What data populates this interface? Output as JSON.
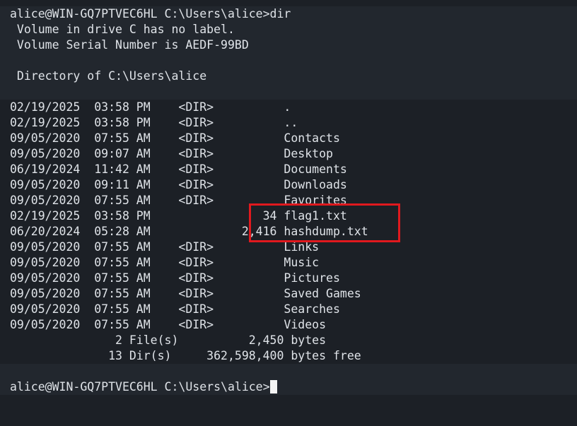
{
  "terminal": {
    "prompt_command": "alice@WIN-GQ7PTVEC6HL C:\\Users\\alice>dir",
    "volume_label": " Volume in drive C has no label.",
    "volume_serial": " Volume Serial Number is AEDF-99BD",
    "directory_of": " Directory of C:\\Users\\alice",
    "entries": [
      "02/19/2025  03:58 PM    <DIR>          .",
      "02/19/2025  03:58 PM    <DIR>          ..",
      "09/05/2020  07:55 AM    <DIR>          Contacts",
      "09/05/2020  09:07 AM    <DIR>          Desktop",
      "06/19/2024  11:42 AM    <DIR>          Documents",
      "09/05/2020  09:11 AM    <DIR>          Downloads",
      "09/05/2020  07:55 AM    <DIR>          Favorites",
      "02/19/2025  03:58 PM                34 flag1.txt",
      "06/20/2024  05:28 AM             2,416 hashdump.txt",
      "09/05/2020  07:55 AM    <DIR>          Links",
      "09/05/2020  07:55 AM    <DIR>          Music",
      "09/05/2020  07:55 AM    <DIR>          Pictures",
      "09/05/2020  07:55 AM    <DIR>          Saved Games",
      "09/05/2020  07:55 AM    <DIR>          Searches",
      "09/05/2020  07:55 AM    <DIR>          Videos"
    ],
    "files_summary": "               2 File(s)          2,450 bytes",
    "dirs_summary": "              13 Dir(s)     362,598,400 bytes free",
    "final_prompt": "alice@WIN-GQ7PTVEC6HL C:\\Users\\alice>"
  },
  "colors": {
    "background": "#1c2026",
    "text": "#dfe3e8",
    "highlight_border": "#e0191e"
  }
}
